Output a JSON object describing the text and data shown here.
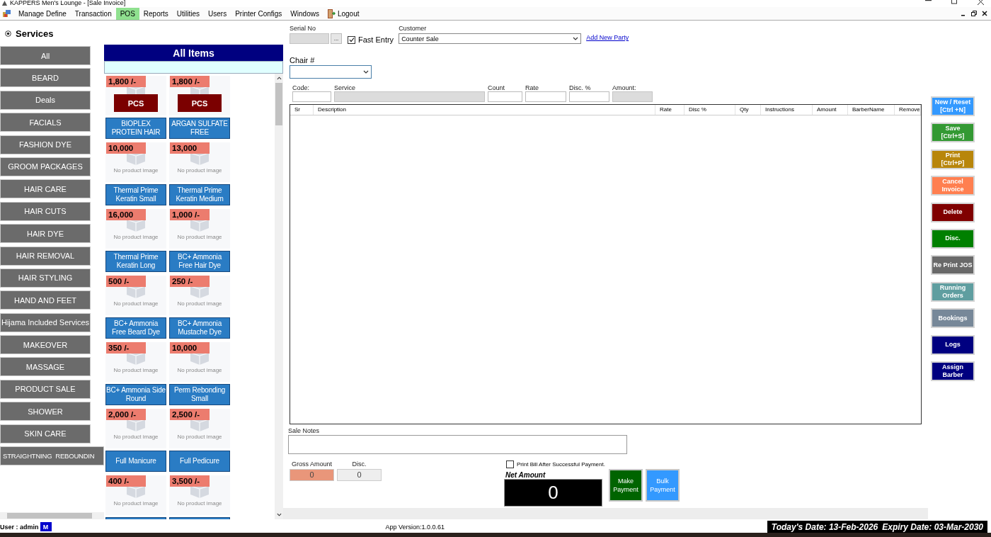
{
  "window": {
    "title": "KAPPERS Men's Lounge - [Sale Invoice]"
  },
  "menu": [
    {
      "label": "Manage Define",
      "selected": false,
      "kind": "item"
    },
    {
      "label": "Transaction",
      "selected": false,
      "kind": "item"
    },
    {
      "label": "POS",
      "selected": true,
      "kind": "item"
    },
    {
      "label": "Reports",
      "selected": false,
      "kind": "item"
    },
    {
      "label": "Utilities",
      "selected": false,
      "kind": "item"
    },
    {
      "label": "Users",
      "selected": false,
      "kind": "item"
    },
    {
      "label": "Printer Configs",
      "selected": false,
      "kind": "item"
    },
    {
      "label": "Windows",
      "selected": false,
      "kind": "item"
    },
    {
      "label": "Logout",
      "selected": false,
      "kind": "logout"
    }
  ],
  "categories": {
    "title": "Services",
    "items": [
      "All",
      "BEARD",
      "Deals",
      "FACIALS",
      "FASHION DYE",
      "GROOM PACKAGES",
      "HAIR CARE",
      "HAIR CUTS",
      "HAIR DYE",
      "HAIR REMOVAL",
      "HAIR STYLING",
      "HAND AND FEET",
      "Hijama Included Services",
      "MAKEOVER",
      "MASSAGE",
      "PRODUCT SALE",
      "SHOWER",
      "SKIN CARE",
      "STRAIGHTNING  REBOUNDIN"
    ]
  },
  "products": {
    "title": "All Items",
    "items": [
      {
        "price": "1,800 /-",
        "unit": "PCS",
        "name": "BIOPLEX PROTEIN HAIR"
      },
      {
        "price": "1,800 /-",
        "unit": "PCS",
        "name": "ARGAN SULFATE FREE"
      },
      {
        "price": "10,000",
        "image_text": "No product image",
        "name": "Thermal Prime Keratin Small"
      },
      {
        "price": "13,000",
        "image_text": "No product image",
        "name": "Thermal Prime Keratin Medium"
      },
      {
        "price": "16,000",
        "image_text": "No product image",
        "name": "Thermal Prime Keratin Long"
      },
      {
        "price": "1,000 /-",
        "image_text": "No product image",
        "name": "BC+ Ammonia Free Hair Dye"
      },
      {
        "price": "500 /-",
        "image_text": "No product image",
        "name": "BC+ Ammonia Free Beard Dye"
      },
      {
        "price": "250 /-",
        "image_text": "No product image",
        "name": "BC+ Ammonia Mustache Dye"
      },
      {
        "price": "350 /-",
        "image_text": "No product image",
        "name": "BC+ Ammonia Side Round"
      },
      {
        "price": "10,000",
        "image_text": "No product image",
        "name": "Perm Rebonding Small"
      },
      {
        "price": "2,000 /-",
        "image_text": "No product image",
        "name": "Full Manicure"
      },
      {
        "price": "2,500 /-",
        "image_text": "No product image",
        "name": "Full Pedicure"
      },
      {
        "price": "400 /-",
        "image_text": "No product image"
      },
      {
        "price": "3,500 /-",
        "image_text": "No product image"
      }
    ]
  },
  "form": {
    "serial_no": {
      "label": "Serial No",
      "button": "..."
    },
    "fast_entry": {
      "label": "Fast Entry",
      "checked": true
    },
    "customer": {
      "label": "Customer",
      "value": "Counter Sale"
    },
    "add_party": "Add New Party",
    "chair": {
      "label": "Chair #"
    },
    "entry_fields": [
      {
        "label": "Code:",
        "disabled": false,
        "kind": "code"
      },
      {
        "label": "Service",
        "disabled": true,
        "kind": "service"
      },
      {
        "label": "Count",
        "disabled": false,
        "kind": "count"
      },
      {
        "label": "Rate",
        "disabled": false,
        "kind": "rate"
      },
      {
        "label": "Disc. %",
        "disabled": false,
        "kind": "disc"
      },
      {
        "label": "Amount:",
        "disabled": true,
        "kind": "amount"
      }
    ],
    "table": {
      "columns": [
        "Sr",
        "Description",
        "Rate",
        "Disc %",
        "Qty",
        "Instructions",
        "Amount",
        "BarberName",
        "Remove"
      ]
    },
    "sale_notes": {
      "label": "Sale Notes"
    },
    "gross_amount": {
      "label": "Gross Amount",
      "value": "0"
    },
    "discount": {
      "label": "Disc.",
      "value": "0"
    },
    "print_bill": {
      "label": "Print Bill After Successful Payment.",
      "checked": false
    },
    "net_amount": {
      "label": "Net Amount",
      "value": "0"
    },
    "payment_buttons": [
      {
        "label": "Make\nPayment",
        "color": "#006400"
      },
      {
        "label": "Bulk\nPayment",
        "color": "#3399ff"
      }
    ]
  },
  "actions": [
    {
      "label": "New / Reset\n[Ctrl +N]",
      "color": "#3399ff"
    },
    {
      "label": "Save\n[Ctrl+S]",
      "color": "#339933"
    },
    {
      "label": "Print\n[Ctrl+P]",
      "color": "#b8860b"
    },
    {
      "label": "Cancel\nInvoice",
      "color": "#ff7f50"
    },
    {
      "label": "Delete",
      "color": "#800000"
    },
    {
      "label": "Disc.",
      "color": "#008000"
    },
    {
      "label": "Re Print JOS",
      "color": "#696969"
    },
    {
      "label": "Running\nOrders",
      "color": "#5f9ea0"
    },
    {
      "label": "Bookings",
      "color": "#778899"
    },
    {
      "label": "Logs",
      "color": "#000080"
    },
    {
      "label": "Assign\nBarber",
      "color": "#000080"
    }
  ],
  "status_bar": {
    "user": "User : admin",
    "badge": "M",
    "version": "App Version:1.0.0.61",
    "today": "Today's Date: 13-Feb-2026",
    "expiry": "Expiry Date: 03-Mar-2030"
  }
}
